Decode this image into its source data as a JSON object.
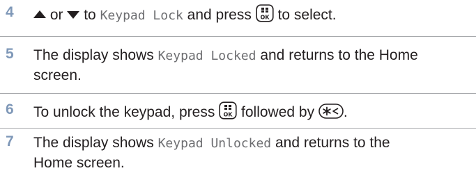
{
  "steps": [
    {
      "number": "4",
      "parts": {
        "or": "or",
        "to": "to",
        "menu_item": "Keypad Lock",
        "and_press": "and press",
        "to_select": "to select."
      },
      "icons": [
        "up-arrow",
        "down-arrow",
        "menu-ok-key"
      ]
    },
    {
      "number": "5",
      "parts": {
        "the_display_shows": "The display shows",
        "status": "Keypad Locked",
        "rest_line1": "and returns to the Home",
        "rest_line2": "screen."
      }
    },
    {
      "number": "6",
      "parts": {
        "intro": "To unlock the keypad, press",
        "followed_by": "followed by",
        "period": "."
      },
      "icons": [
        "menu-ok-key",
        "star-key"
      ]
    },
    {
      "number": "7",
      "parts": {
        "the_display_shows": "The display shows",
        "status": "Keypad Unlocked",
        "rest_line1": "and returns to the",
        "rest_line2": "Home screen."
      }
    }
  ],
  "key_labels": {
    "ok": "OK"
  },
  "colors": {
    "step_number": "#7f98b8",
    "text": "#231f20",
    "mono_text": "#6d6e71",
    "rule": "#a7a9ac"
  }
}
